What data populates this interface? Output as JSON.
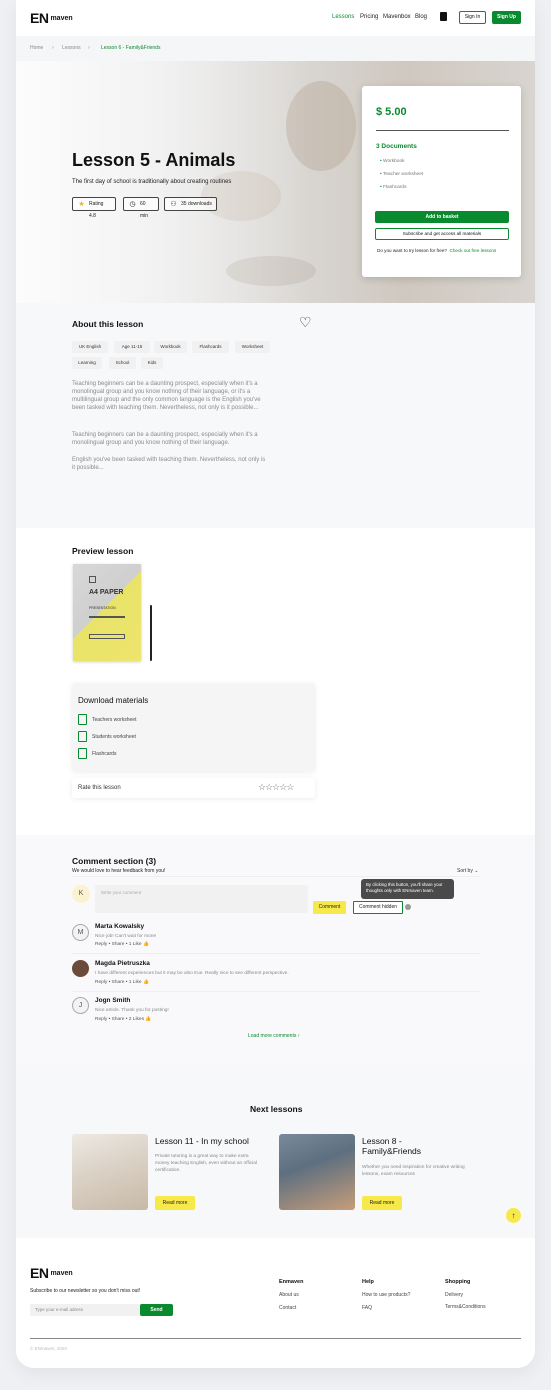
{
  "header": {
    "logo_text": "EN",
    "logo_sub": "maven",
    "nav": [
      "Lessons",
      "Pricing",
      "Mavenbox",
      "Blog"
    ],
    "sign_in": "Sign In",
    "sign_up": "Sign Up"
  },
  "breadcrumb": [
    "Home",
    "Lessons",
    "Lesson 6 - Family&Friends"
  ],
  "hero": {
    "title": "Lesson 5 - Animals",
    "subtitle": "The first day of school is traditionally about creating routines",
    "rating": "Rating 4.8",
    "duration": "60 min",
    "downloads": "35 downloads"
  },
  "price_card": {
    "price": "$ 5.00",
    "docs_title": "3 Documents",
    "docs": [
      "Workbook",
      "Teacher worksheet",
      "Flashcards"
    ],
    "add_to_basket": "Add to basket",
    "subscribe": "Subscribe and get access all materials",
    "free_text": "Do you want to try lesson for free?",
    "free_link": "Check out free lessons"
  },
  "about": {
    "title": "About this lesson",
    "tags": [
      "UK English",
      "Age 11-15",
      "Workbook",
      "Flashcards",
      "Worksheet",
      "Learning",
      "School",
      "Kids"
    ],
    "paragraphs": [
      "Teaching beginners can be a daunting prospect, especially when it's a monolingual group and you know nothing of their language, or it's a multilingual group and the only common language is the English you've been tasked with teaching them. Nevertheless, not only is it possible...",
      "Teaching beginners can be a daunting prospect, especially when it's a monolingual group and you know nothing of their language.",
      "English you've been tasked with teaching them. Nevertheless, not only is it possible..."
    ]
  },
  "preview": {
    "title": "Preview lesson",
    "paper_title": "A4 PAPER",
    "paper_sub": "PRESENTATION"
  },
  "download": {
    "title": "Download materials",
    "items": [
      "Teachers worksheet",
      "Students worksheet",
      "Flashcards"
    ],
    "rate_label": "Rate this lesson"
  },
  "comments": {
    "title": "Comment section (3)",
    "subtitle": "We would love to hear feedback from you!",
    "sort": "Sort by",
    "input_placeholder": "Write your comment",
    "user_initial": "K",
    "comment_btn": "Comment",
    "hidden_btn": "Comment hidden",
    "tooltip": "By clicking this button, you'll share your thoughts only with ENmaven team.",
    "list": [
      {
        "initial": "M",
        "name": "Marta Kowalsky",
        "text": "Nice job! Can't wait for more!",
        "likes": "1 Like"
      },
      {
        "initial": "",
        "name": "Magda Pietruszka",
        "text": "I have different experiences but it may be also true. Really nice to see different perspective.",
        "likes": "1 Like"
      },
      {
        "initial": "J",
        "name": "Jogn Smith",
        "text": "Nice article. Thank you for posting!",
        "likes": "2 Likes"
      }
    ],
    "reply": "Reply",
    "share": "Share",
    "load_more": "Load more comments"
  },
  "next": {
    "title": "Next lessons",
    "cards": [
      {
        "title": "Lesson 11 -  In my school",
        "text": "Private tutoring is a great way to make extra money teaching English, even without an official certification.",
        "btn": "Read more"
      },
      {
        "title": "Lesson 8 - Family&Friends",
        "text": "Whether you need inspiration for creative writing lessons, exam resources",
        "btn": "Read more"
      }
    ]
  },
  "footer": {
    "newsletter": "Subscribe to our newsletter so you don't miss out!",
    "email_placeholder": "Type your e-mail adress",
    "send": "Send",
    "col1_title": "Enmaven",
    "col1": [
      "About us",
      "Contact"
    ],
    "col2_title": "Help",
    "col2": [
      "How to use products?",
      "FAQ"
    ],
    "col3_title": "Shopping",
    "col3": [
      "Delivery",
      "Terms&Conditions"
    ],
    "copyright": "© ENmaven, 2020"
  },
  "colors": {
    "brand": "#0a8a2f",
    "accent": "#f7e94a"
  }
}
